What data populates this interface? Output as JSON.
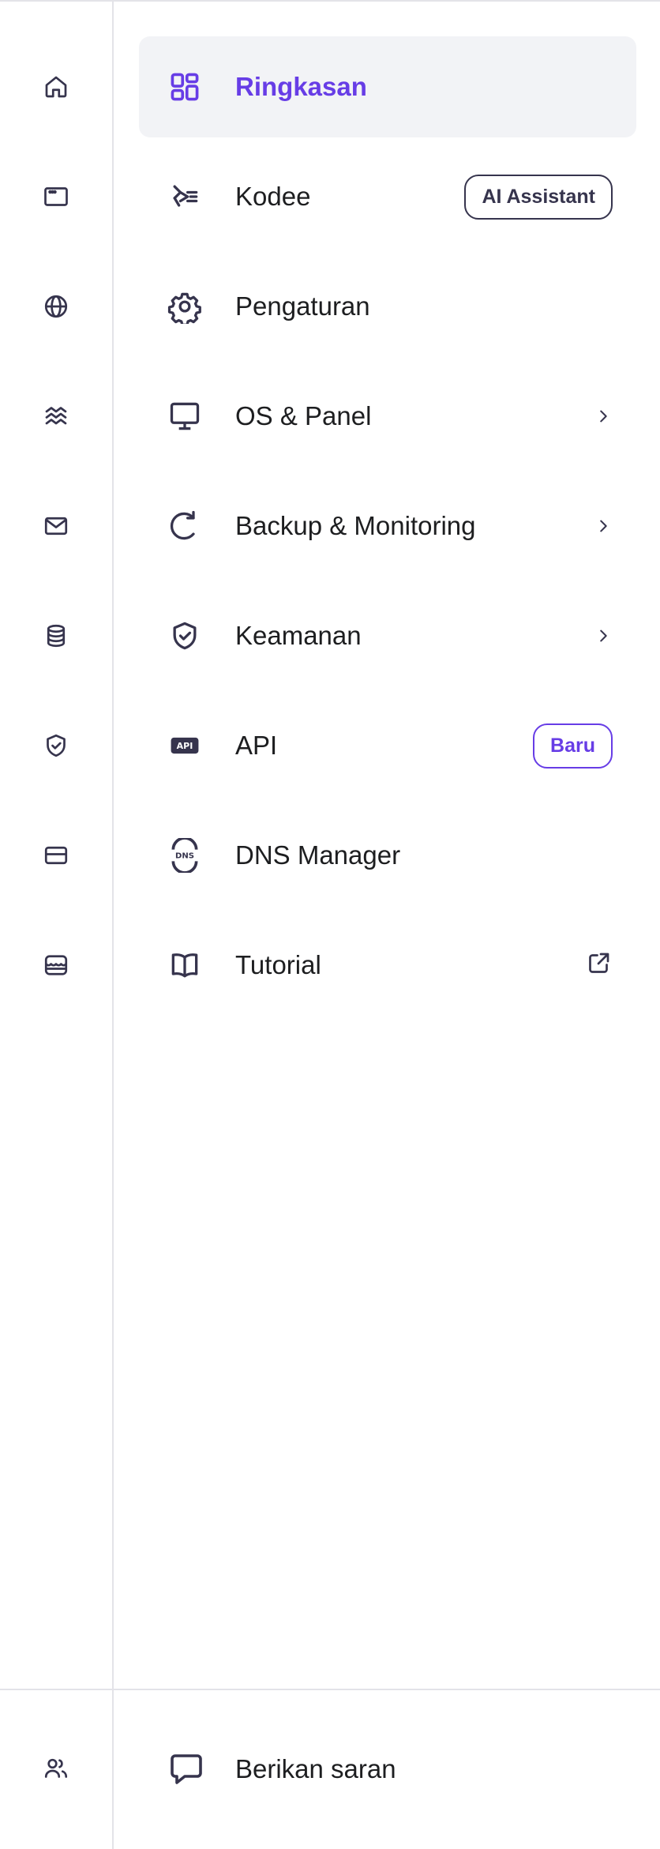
{
  "rail": {
    "icons": [
      "home-icon",
      "browser-window-icon",
      "globe-icon",
      "wind-waves-icon",
      "mail-icon",
      "database-icon",
      "shield-check-icon",
      "credit-card-icon",
      "store-icon"
    ],
    "bottom_icon": "users-icon"
  },
  "menu": {
    "items": [
      {
        "label": "Ringkasan",
        "icon": "dashboard-grid-icon",
        "active": true
      },
      {
        "label": "Kodee",
        "icon": "kodee-ai-icon",
        "badge": "AI Assistant"
      },
      {
        "label": "Pengaturan",
        "icon": "gear-icon"
      },
      {
        "label": "OS & Panel",
        "icon": "monitor-icon",
        "chevron": true
      },
      {
        "label": "Backup & Monitoring",
        "icon": "refresh-icon",
        "chevron": true
      },
      {
        "label": "Keamanan",
        "icon": "shield-check-icon",
        "chevron": true
      },
      {
        "label": "API",
        "icon": "api-icon",
        "badge": "Baru"
      },
      {
        "label": "DNS Manager",
        "icon": "dns-icon"
      },
      {
        "label": "Tutorial",
        "icon": "book-icon",
        "external": true
      }
    ]
  },
  "footer": {
    "feedback_label": "Berikan saran",
    "feedback_icon": "chat-bubble-icon"
  },
  "colors": {
    "accent": "#673de6",
    "active_bg": "#f2f3f6",
    "text": "#1d1e20",
    "icon": "#36344d",
    "divider": "#e3e3e8"
  }
}
